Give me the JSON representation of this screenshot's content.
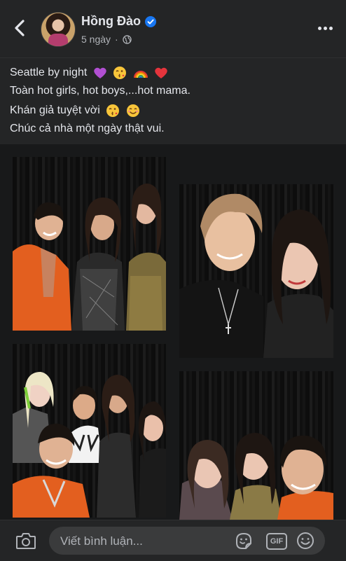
{
  "header": {
    "name": "Hồng Đào",
    "time": "5 ngày",
    "separator": "·"
  },
  "post": {
    "line1": "Seattle by night",
    "line2": "Toàn hot girls, hot boys,...hot mama.",
    "line3": "Khán giả tuyệt vời",
    "line4": "Chúc cả nhà một ngày thật vui.",
    "line1_emojis": [
      "purple-heart",
      "kiss-wink",
      "rainbow",
      "red-heart"
    ],
    "line3_emojis": [
      "kiss-wink",
      "smiling-face"
    ]
  },
  "photos": [
    {
      "name": "group-photo-1"
    },
    {
      "name": "selfie-photo-2"
    },
    {
      "name": "group-photo-3"
    },
    {
      "name": "selfie-photo-4"
    }
  ],
  "footer": {
    "comment_placeholder": "Viết bình luận...",
    "gif_label": "GIF"
  },
  "colors": {
    "background": "#18191a",
    "surface": "#242526",
    "text": "#e4e6eb",
    "secondary_text": "#b0b3b8",
    "verified": "#1877f2",
    "input": "#3a3b3c"
  }
}
